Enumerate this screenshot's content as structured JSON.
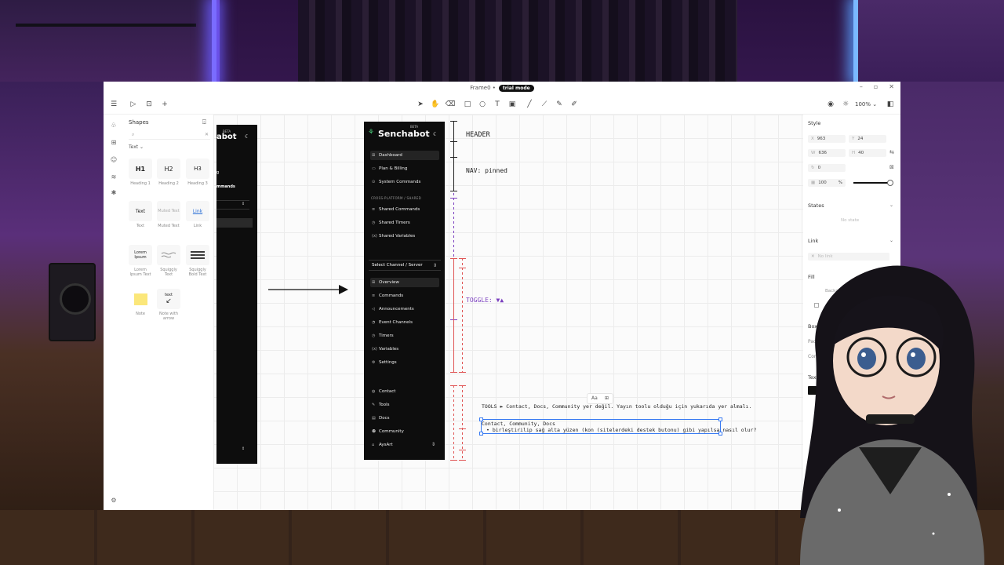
{
  "window": {
    "title": "Frame0 •",
    "trial_badge": "trial mode"
  },
  "toolbar": {
    "zoom_value": "100%"
  },
  "shapes_panel": {
    "title": "Shapes",
    "search_placeholder": "",
    "category": "Text ⌄",
    "tiles": [
      {
        "glyph": "H1",
        "label": "Heading 1"
      },
      {
        "glyph": "H2",
        "label": "Heading 2"
      },
      {
        "glyph": "H3",
        "label": "Heading 3"
      },
      {
        "glyph": "Text",
        "label": "Text"
      },
      {
        "glyph": "Muted Text",
        "label": "Muted Text"
      },
      {
        "glyph": "Link",
        "label": "Link"
      },
      {
        "glyph": "Lorem Ipsum",
        "label": "Lorem Ipsum Text"
      },
      {
        "glyph": "",
        "label": "Squiggly Text"
      },
      {
        "glyph": "",
        "label": "Squiggly Bold Text"
      },
      {
        "glyph": "",
        "label": "Note"
      },
      {
        "glyph": "text",
        "label": "Note with arrow"
      }
    ]
  },
  "mock_old": {
    "brand": "abot",
    "beta": "BETA",
    "line1": "g",
    "line2": "mmands"
  },
  "mock_new": {
    "brand": "Senchabot",
    "beta": "BETA",
    "nav_top": [
      "Dashboard",
      "Plan & Billing",
      "System Commands"
    ],
    "section_label": "CROSS-PLATFORM / SHARED",
    "nav_shared": [
      "Shared Commands",
      "Shared Timers",
      "Shared Variables"
    ],
    "select_label": "Select Channel / Server",
    "nav_channel": [
      "Overview",
      "Commands",
      "Announcements",
      "Event Channels",
      "Timers",
      "Variables",
      "Settings"
    ],
    "nav_bottom": [
      "Contact",
      "Tools",
      "Docs",
      "Community"
    ],
    "user": "AysArt"
  },
  "annotations": {
    "header": "HEADER",
    "nav": "NAV: pinned",
    "toggle": "TOGGLE: ▼▲",
    "tools": "TOOLS ► Contact, Docs, Community yer değil. Yayın toolu olduğu için yukarıda yer almalı.",
    "selected_line1": "Contact, Community, Docs",
    "selected_line2": "• birleştirilip sağ alta yüzen (kon (sitelerdeki destek butonu) gibi yapılsa nasıl olur?",
    "mini_toolbar": "Aa"
  },
  "colors": {
    "accent_purple": "#7b3fbf",
    "marker_red": "#e05555",
    "marker_black": "#222222"
  },
  "props": {
    "style_label": "Style",
    "x_label": "X",
    "x_value": "963",
    "y_label": "Y",
    "y_value": "24",
    "w_label": "W",
    "w_value": "636",
    "h_label": "H",
    "h_value": "40",
    "rotation_value": "0",
    "opacity_value": "100",
    "opacity_unit": "%",
    "states_label": "States",
    "states_empty": "No state",
    "link_label": "Link",
    "link_value": "No link",
    "fill_label": "Fill",
    "fill_value": "Background",
    "box_label": "Box",
    "padding_label": "Padding",
    "corners_label": "Corners",
    "text_label": "Text"
  }
}
